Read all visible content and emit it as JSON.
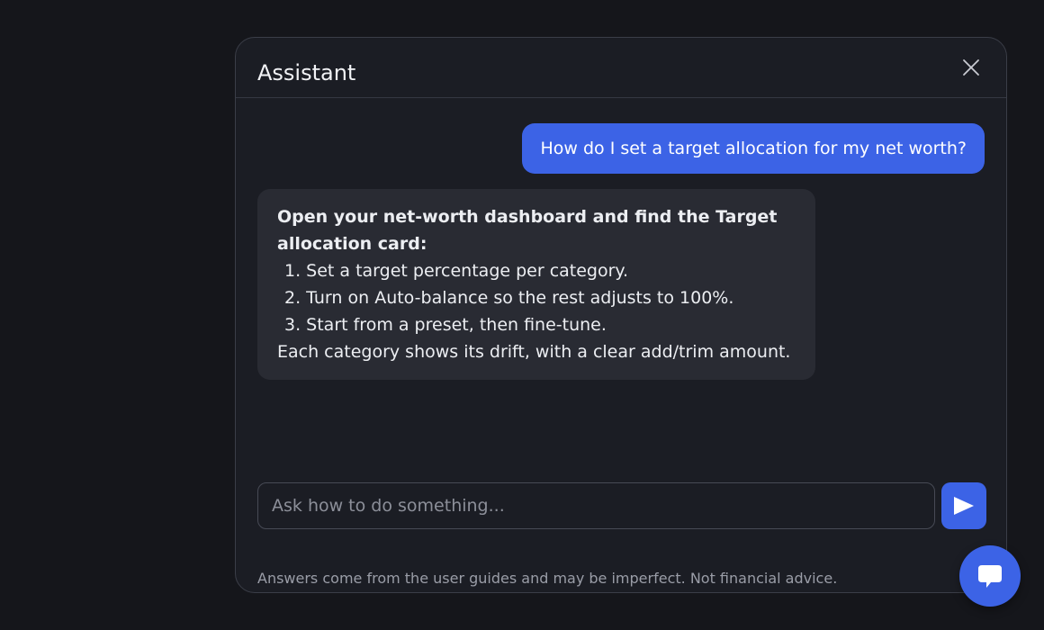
{
  "panel": {
    "title": "Assistant",
    "close_icon": "close-icon"
  },
  "messages": {
    "user": {
      "text": "How do I set a target allocation for my net worth?"
    },
    "assistant": {
      "intro": "Open your net-worth dashboard and find the Target allocation card:",
      "steps": [
        "1. Set a target percentage per category.",
        "2. Turn on Auto-balance so the rest adjusts to 100%.",
        "3. Start from a preset, then fine-tune."
      ],
      "outro": "Each category shows its drift, with a clear add/trim amount."
    }
  },
  "composer": {
    "placeholder": "Ask how to do something...",
    "value": "",
    "send_icon": "send-icon"
  },
  "disclaimer": "Answers come from the user guides and may be imperfect. Not financial advice.",
  "fab": {
    "icon": "chat-bubble-icon"
  },
  "colors": {
    "background": "#15161b",
    "panel": "#1b1d24",
    "accent": "#3c63e6",
    "assistant_bubble": "#292b33",
    "muted_text": "#9a9da7"
  }
}
